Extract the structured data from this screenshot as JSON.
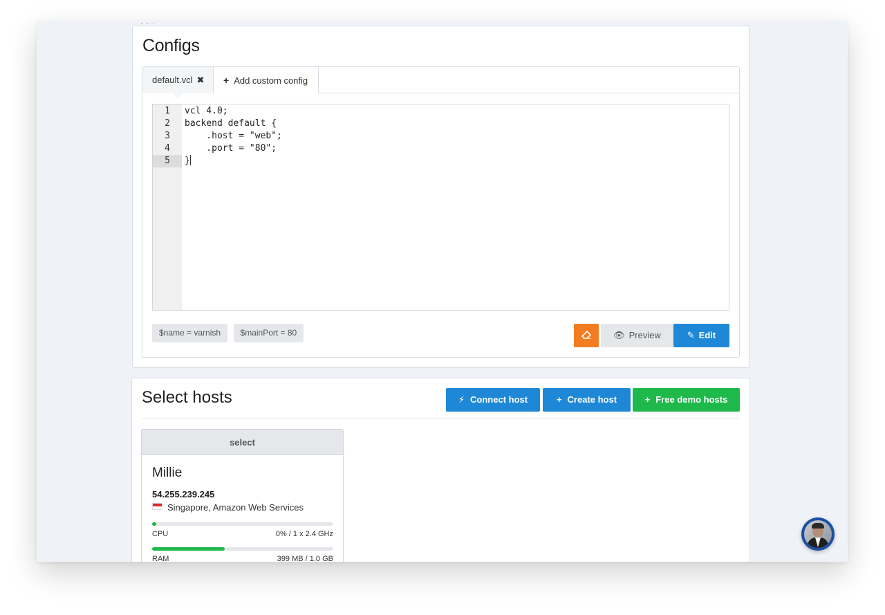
{
  "configs": {
    "title": "Configs",
    "tabs": [
      {
        "label": "default.vcl"
      },
      {
        "label": "Add custom config"
      }
    ],
    "editor": {
      "lines": [
        {
          "n": "1",
          "text": "vcl 4.0;"
        },
        {
          "n": "2",
          "text": "backend default {"
        },
        {
          "n": "3",
          "text": "    .host = \"web\";"
        },
        {
          "n": "4",
          "text": "    .port = \"80\";"
        },
        {
          "n": "5",
          "text": "}"
        }
      ]
    },
    "variables": [
      "$name = varnish",
      "$mainPort = 80"
    ],
    "buttons": {
      "preview": "Preview",
      "edit": "Edit"
    }
  },
  "hosts": {
    "title": "Select hosts",
    "buttons": {
      "connect": "Connect host",
      "create": "Create host",
      "demo": "Free demo hosts"
    },
    "card": {
      "select_label": "select",
      "name": "Millie",
      "ip": "54.255.239.245",
      "location": "Singapore, Amazon Web Services",
      "cpu": {
        "label": "CPU",
        "value": "0% / 1 x 2.4 GHz",
        "fill_fraction": 0.02
      },
      "ram": {
        "label": "RAM",
        "value": "399 MB / 1.0 GB",
        "fill_fraction": 0.4
      }
    }
  },
  "icons": [
    "close-icon",
    "plus-icon",
    "eraser-icon",
    "eye-icon",
    "edit-icon",
    "plug-icon",
    "flag-icon"
  ],
  "colors": {
    "primary": "#1f88d6",
    "success": "#1fb84a",
    "warning": "#f47c20",
    "neutral_button": "#e5e7ea",
    "avatar_ring": "#1d4fa3"
  }
}
